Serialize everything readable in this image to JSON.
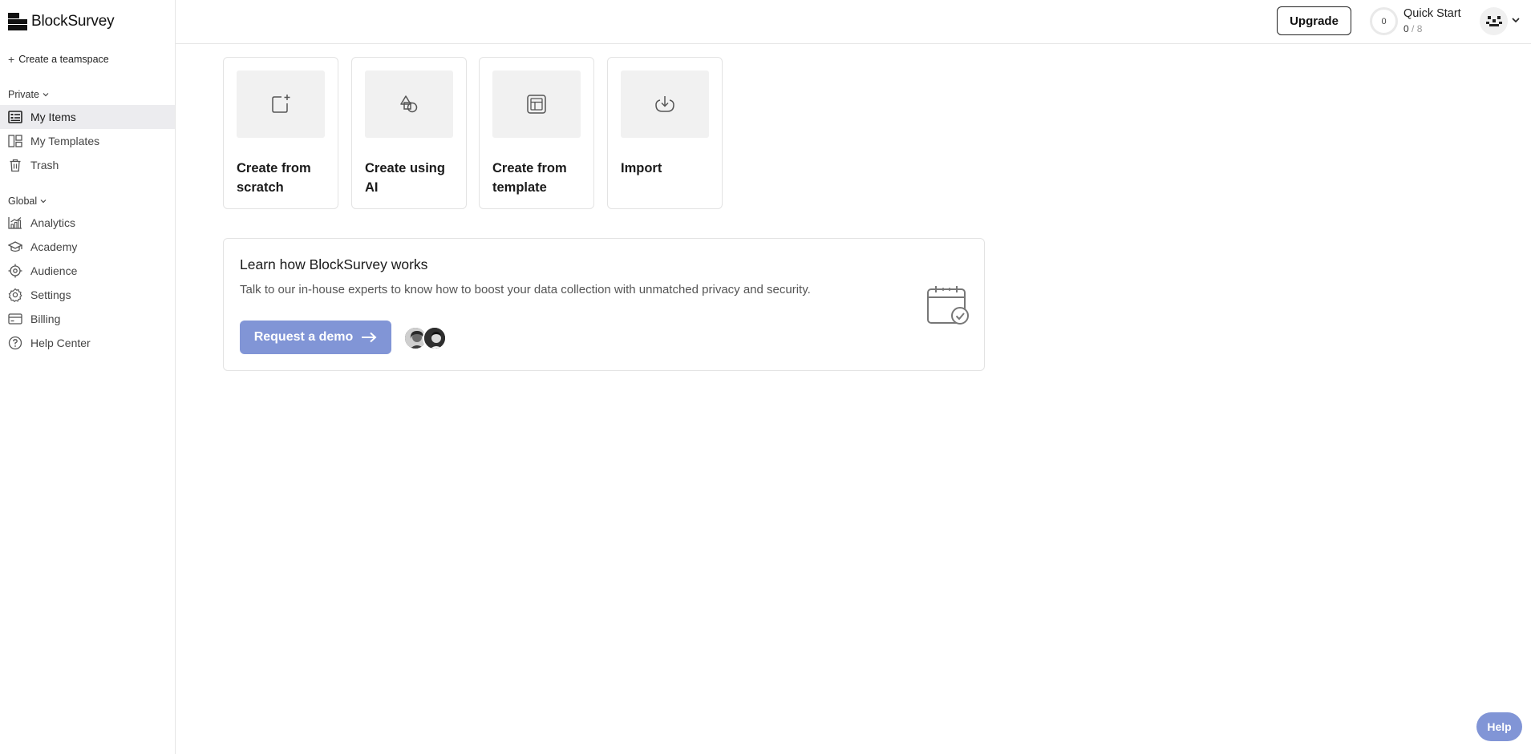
{
  "app": {
    "brand": "BlockSurvey"
  },
  "sidebar": {
    "create_teamspace": "Create a teamspace",
    "private_label": "Private",
    "private_items": [
      {
        "label": "My Items",
        "icon": "list-icon",
        "active": true
      },
      {
        "label": "My Templates",
        "icon": "templates-icon",
        "active": false
      },
      {
        "label": "Trash",
        "icon": "trash-icon",
        "active": false
      }
    ],
    "global_label": "Global",
    "global_items": [
      {
        "label": "Analytics",
        "icon": "analytics-icon"
      },
      {
        "label": "Academy",
        "icon": "graduation-cap-icon"
      },
      {
        "label": "Audience",
        "icon": "target-icon"
      },
      {
        "label": "Settings",
        "icon": "gear-icon"
      },
      {
        "label": "Billing",
        "icon": "credit-card-icon"
      },
      {
        "label": "Help Center",
        "icon": "question-circle-icon"
      }
    ]
  },
  "topbar": {
    "upgrade_label": "Upgrade",
    "quick_start": {
      "ring_value": "0",
      "title": "Quick Start",
      "done": "0",
      "total": " / 8"
    }
  },
  "create_cards": [
    {
      "label": "Create from scratch",
      "icon": "new-document-icon"
    },
    {
      "label": "Create using AI",
      "icon": "shapes-icon"
    },
    {
      "label": "Create from template",
      "icon": "template-layout-icon"
    },
    {
      "label": "Import",
      "icon": "import-icon"
    }
  ],
  "learn": {
    "title": "Learn how BlockSurvey works",
    "description": "Talk to our in-house experts to know how to boost your data collection with unmatched privacy and security.",
    "demo_label": "Request a demo"
  },
  "help_label": "Help",
  "colors": {
    "accent": "#8195d6",
    "active_bg": "#ececef",
    "border": "#e3e3e3"
  }
}
